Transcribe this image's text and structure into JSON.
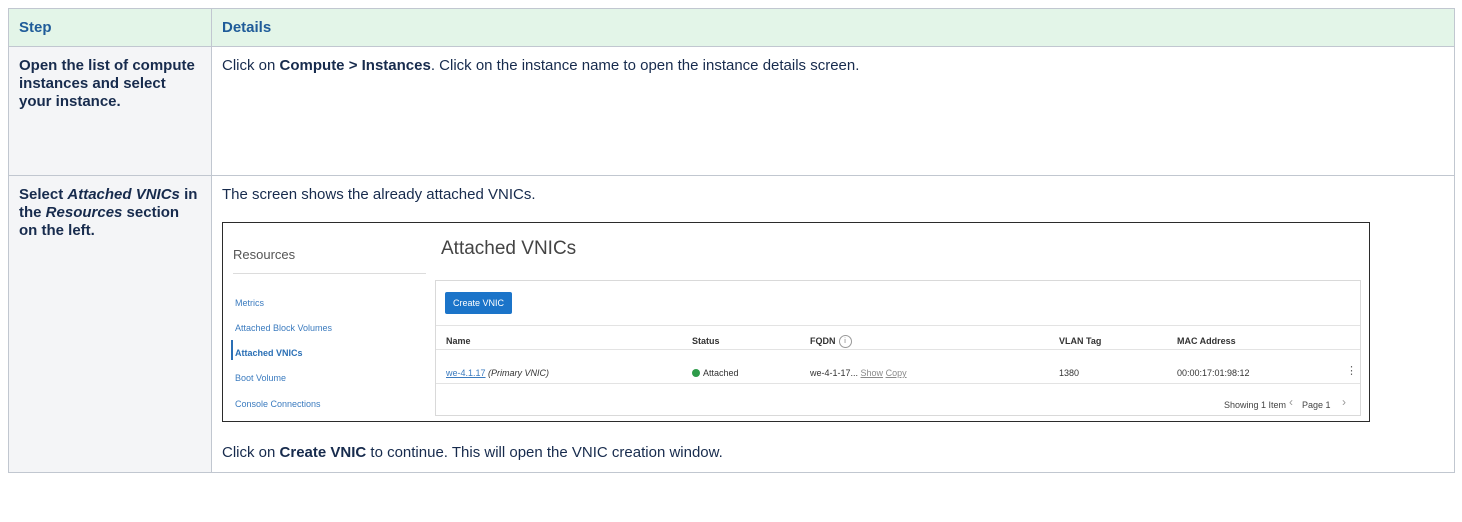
{
  "table": {
    "headers": {
      "step": "Step",
      "details": "Details"
    },
    "row1": {
      "step": "Open the list of compute instances and select your instance.",
      "details_prefix": "Click on ",
      "details_bold": "Compute > Instances",
      "details_suffix": ". Click on the instance name to open the instance details screen."
    },
    "row2": {
      "step_p1": "Select ",
      "step_i1": "Attached VNICs",
      "step_p2": " in the ",
      "step_i2": "Resources",
      "step_p3": " section on the left.",
      "intro": "The screen shows the already attached VNICs.",
      "outro_prefix": "Click on ",
      "outro_bold": "Create VNIC",
      "outro_suffix": " to continue. This will open the VNIC creation window."
    }
  },
  "screenshot": {
    "resources_title": "Resources",
    "resources_items": [
      "Metrics",
      "Attached Block Volumes",
      "Attached VNICs",
      "Boot Volume",
      "Console Connections"
    ],
    "active_item": "Attached VNICs",
    "panel_title": "Attached VNICs",
    "create_button": "Create VNIC",
    "columns": [
      "Name",
      "Status",
      "FQDN",
      "VLAN Tag",
      "MAC Address"
    ],
    "row": {
      "name_link": "we-4.1.17",
      "name_note": "(Primary VNIC)",
      "status": "Attached",
      "fqdn": "we-4-1-17...",
      "fqdn_show": "Show",
      "fqdn_copy": "Copy",
      "vlan": "1380",
      "mac": "00:00:17:01:98:12",
      "menu": "⋮"
    },
    "footer": {
      "showing": "Showing 1 Item",
      "page": "Page 1"
    },
    "icons": {
      "status": "green-dot-icon",
      "fqdn_info": "info-icon",
      "prev": "chevron-left-icon",
      "next": "chevron-right-icon"
    },
    "status_color": "#2e9b4a",
    "button_color": "#1b74c9"
  }
}
